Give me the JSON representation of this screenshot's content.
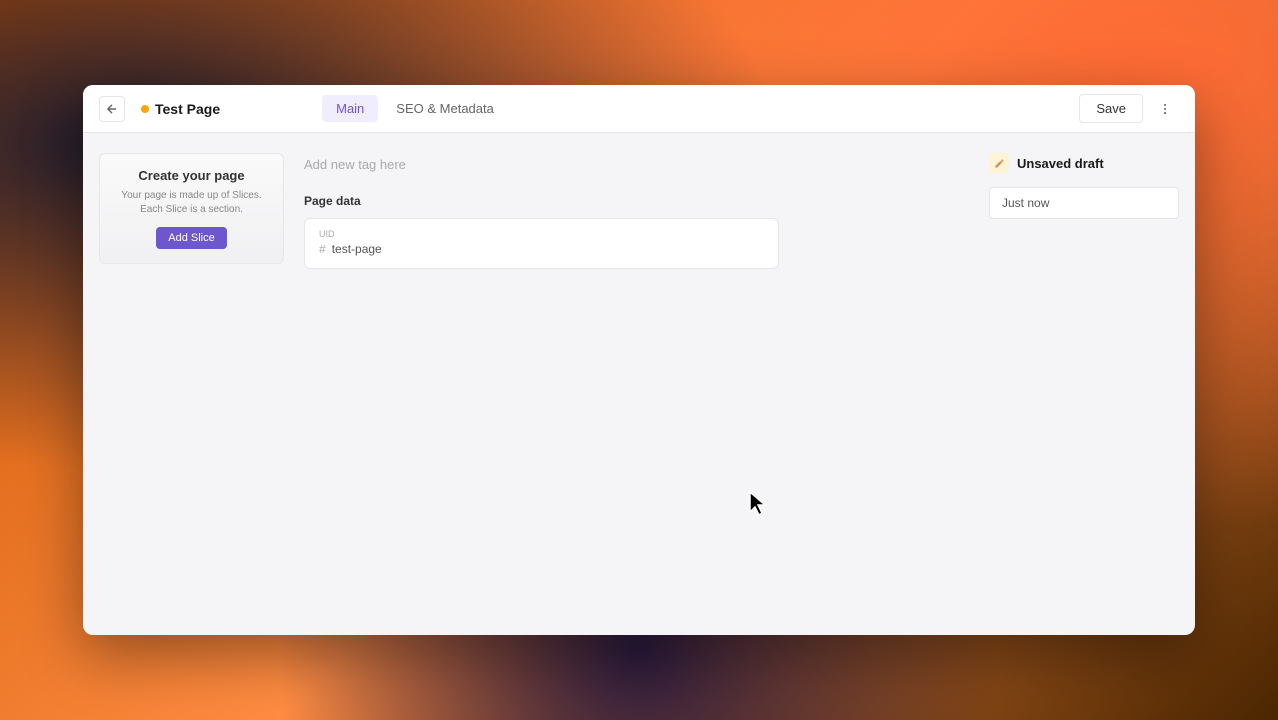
{
  "header": {
    "page_title": "Test Page",
    "tabs": [
      {
        "label": "Main",
        "active": true
      },
      {
        "label": "SEO & Metadata",
        "active": false
      }
    ],
    "save_label": "Save"
  },
  "left_panel": {
    "create_title": "Create your page",
    "create_desc_line1": "Your page is made up of Slices.",
    "create_desc_line2": "Each Slice is a section.",
    "add_slice_label": "Add Slice"
  },
  "main_panel": {
    "tag_placeholder": "Add new tag here",
    "page_data_label": "Page data",
    "uid_label": "UID",
    "uid_value": "test-page"
  },
  "right_panel": {
    "draft_label": "Unsaved draft",
    "version_time": "Just now"
  }
}
